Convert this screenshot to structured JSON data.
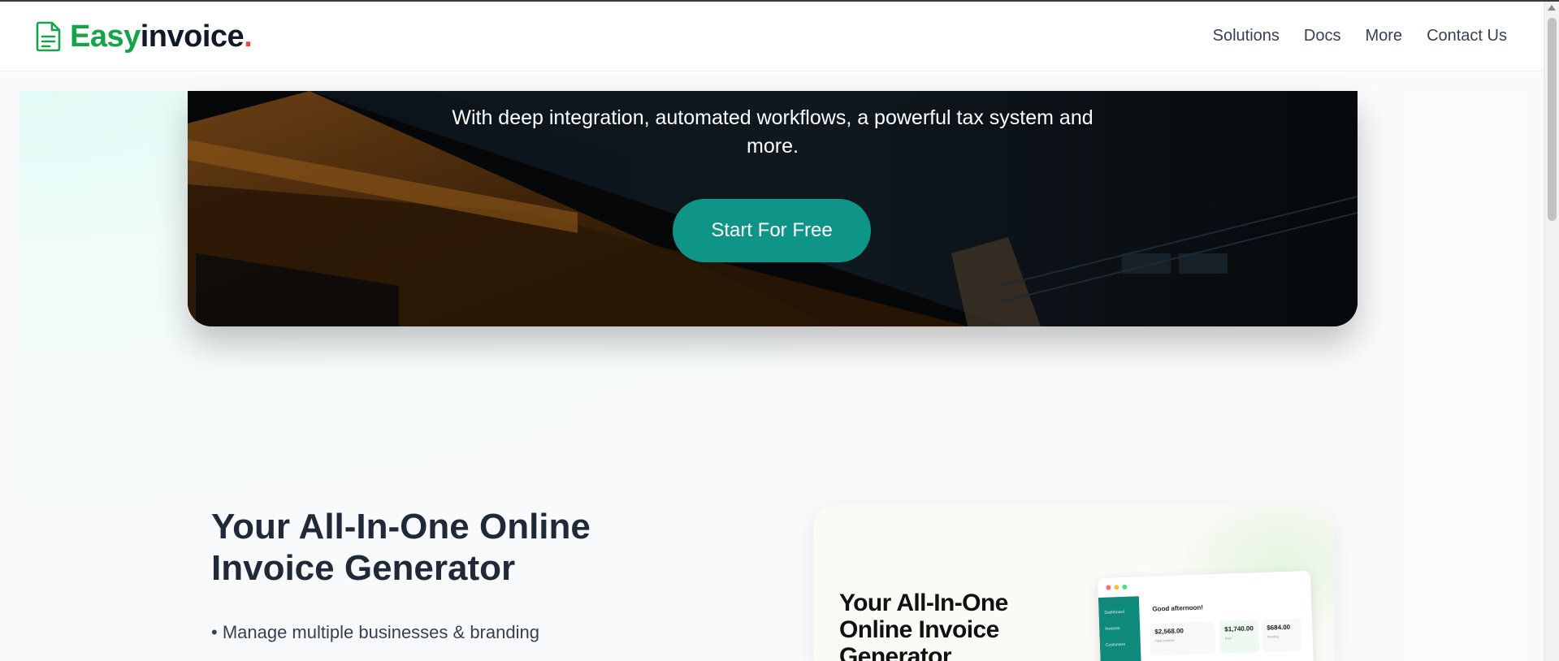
{
  "header": {
    "logo": {
      "brand_part1": "Easy",
      "brand_part2": "invoice",
      "brand_dot": ".",
      "icon": "document-icon"
    },
    "nav": [
      {
        "label": "Solutions"
      },
      {
        "label": "Docs"
      },
      {
        "label": "More"
      },
      {
        "label": "Contact Us"
      }
    ]
  },
  "hero": {
    "subtitle": "With deep integration, automated workflows, a powerful tax system and more.",
    "cta_label": "Start For Free"
  },
  "feature": {
    "title": "Your All-In-One Online Invoice Generator",
    "bullets": [
      "• Manage multiple businesses & branding"
    ]
  },
  "preview": {
    "title": "Your All-In-One Online Invoice Generator",
    "mini_app": {
      "greeting": "Good afternoon!",
      "sidebar_items": [
        "Dashboard",
        "Invoices",
        "Customers"
      ],
      "stats": [
        {
          "value": "$2,568.00",
          "label": "Total invoices"
        },
        {
          "value": "$1,740.00",
          "label": "Paid"
        },
        {
          "value": "$684.00",
          "label": "Pending"
        }
      ]
    }
  },
  "colors": {
    "brand_green": "#16a34a",
    "brand_dot_red": "#ef4444",
    "cta_teal": "#0f9488",
    "hero_dark": "#050506",
    "text_dark": "#1f2937"
  }
}
